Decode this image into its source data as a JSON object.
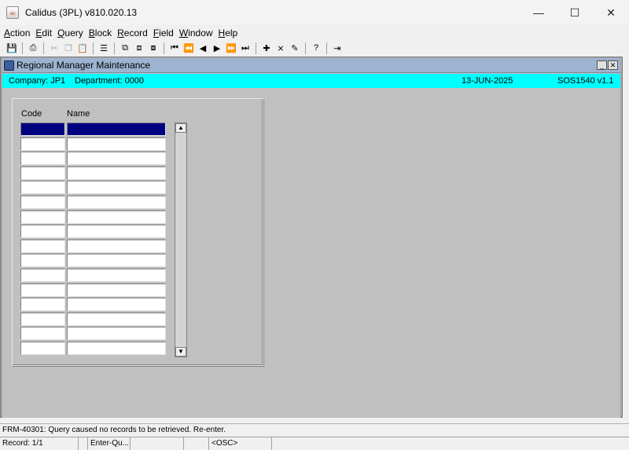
{
  "window": {
    "title": "Calidus (3PL) v810.020.13",
    "minimize": "—",
    "maximize": "☐",
    "close": "✕"
  },
  "menu": [
    {
      "u": "A",
      "rest": "ction"
    },
    {
      "u": "E",
      "rest": "dit"
    },
    {
      "u": "Q",
      "rest": "uery"
    },
    {
      "u": "B",
      "rest": "lock"
    },
    {
      "u": "R",
      "rest": "ecord"
    },
    {
      "u": "F",
      "rest": "ield"
    },
    {
      "u": "W",
      "rest": "indow"
    },
    {
      "u": "H",
      "rest": "elp"
    }
  ],
  "form": {
    "title": "Regional Manager Maintenance",
    "company": "Company:  JP1",
    "department": "Department:  0000",
    "date": "13-JUN-2025",
    "screen_id": "SOS1540  v1.1",
    "columns": {
      "code": "Code",
      "name": "Name"
    }
  },
  "status": {
    "message": "FRM-40301: Query caused no records to be retrieved. Re-enter.",
    "record": "Record: 1/1",
    "mode": "Enter-Qu...",
    "osc": "<OSC>"
  }
}
